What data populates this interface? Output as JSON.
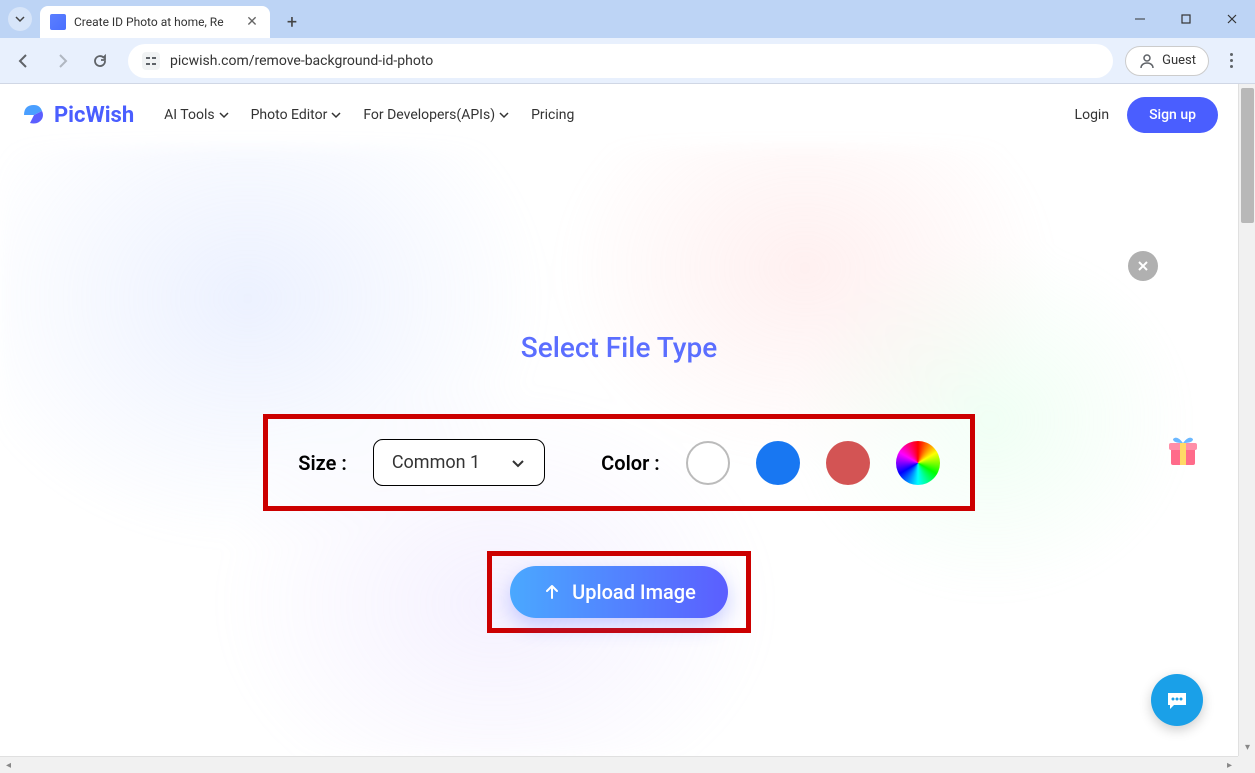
{
  "browser": {
    "tab_title": "Create ID Photo at home, Re",
    "url": "picwish.com/remove-background-id-photo",
    "guest_label": "Guest"
  },
  "navbar": {
    "brand": "PicWish",
    "links": {
      "ai_tools": "AI Tools",
      "photo_editor": "Photo Editor",
      "developers": "For Developers(APIs)",
      "pricing": "Pricing"
    },
    "login": "Login",
    "signup": "Sign up"
  },
  "modal": {
    "title": "Select File Type",
    "size_label": "Size :",
    "size_value": "Common 1",
    "color_label": "Color :",
    "colors": [
      "white",
      "blue",
      "red",
      "rainbow"
    ],
    "upload_label": "Upload Image"
  }
}
